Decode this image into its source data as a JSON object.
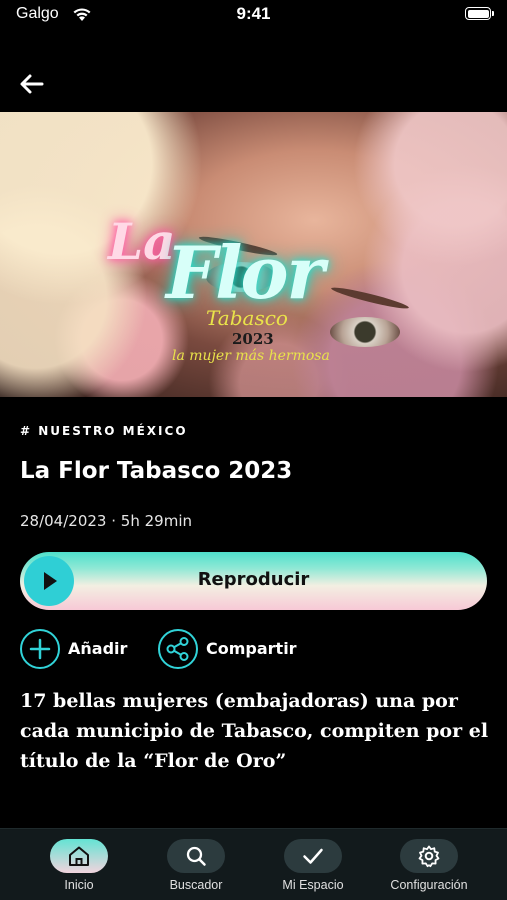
{
  "status_bar": {
    "carrier": "Galgo",
    "time": "9:41"
  },
  "episode": {
    "category": "# NUESTRO MÉXICO",
    "title": "La Flor Tabasco 2023",
    "date": "28/04/2023",
    "duration": "5h 29min",
    "description": "17 bellas mujeres (embajadoras) una por cada municipio de Tabasco, compiten por el título de la “Flor de Oro”"
  },
  "artwork": {
    "logo_la": "La",
    "logo_flor": "Flor",
    "logo_tabasco": "Tabasco",
    "logo_year": "2023",
    "logo_tagline": "la mujer más hermosa"
  },
  "actions": {
    "play_label": "Reproducir",
    "add_label": "Añadir",
    "share_label": "Compartir"
  },
  "tab_bar": {
    "items": [
      {
        "label": "Inicio",
        "icon": "home-icon",
        "active": true
      },
      {
        "label": "Buscador",
        "icon": "search-icon",
        "active": false
      },
      {
        "label": "Mi Espacio",
        "icon": "check-icon",
        "active": false
      },
      {
        "label": "Configuración",
        "icon": "gear-icon",
        "active": false
      }
    ]
  },
  "colors": {
    "accent": "#31d3d8",
    "background": "#000000",
    "tab_bar_bg": "#121a1c"
  }
}
